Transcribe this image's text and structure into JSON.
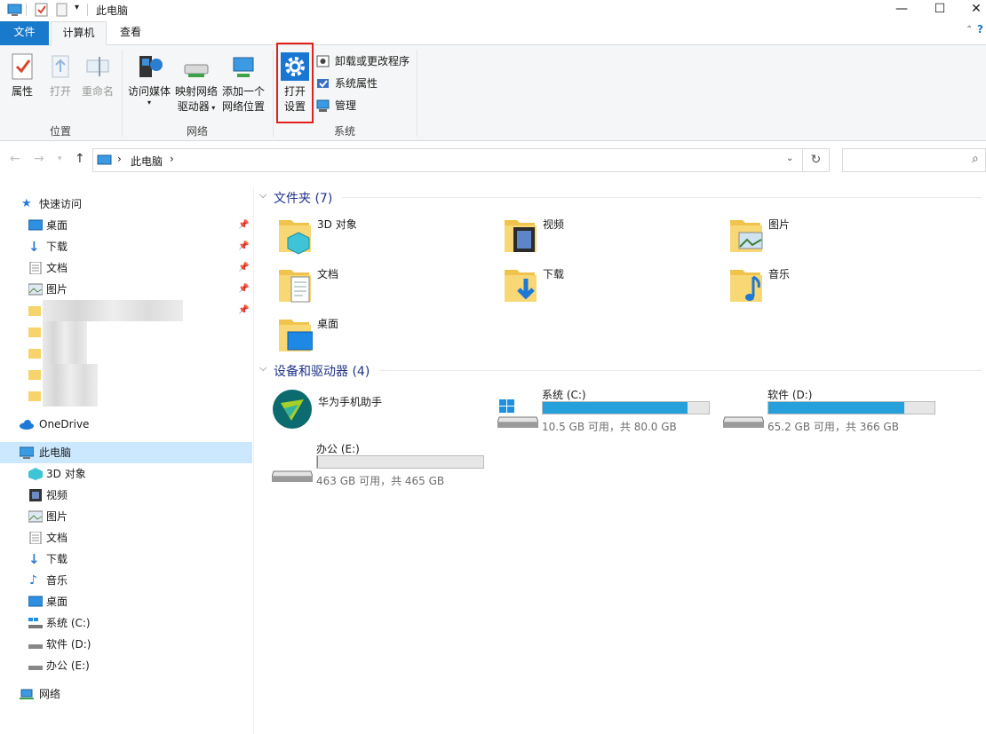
{
  "titlebar": {
    "title": "此电脑",
    "min": "—",
    "max": "☐",
    "close": "✕"
  },
  "tabs": {
    "file": "文件",
    "computer": "计算机",
    "view": "查看"
  },
  "ribbon": {
    "location": {
      "label": "位置",
      "properties": "属性",
      "open": "打开",
      "rename": "重命名"
    },
    "network": {
      "label": "网络",
      "access_media_1": "访问媒体",
      "map_drive_1": "映射网络",
      "map_drive_2": "驱动器",
      "add_location_1": "添加一个",
      "add_location_2": "网络位置"
    },
    "system": {
      "label": "系统",
      "open_settings_1": "打开",
      "open_settings_2": "设置",
      "uninstall": "卸载或更改程序",
      "sys_props": "系统属性",
      "manage": "管理"
    }
  },
  "address": {
    "path": "此电脑",
    "chevron": "›",
    "refresh": "↻",
    "search_icon": "⌕"
  },
  "nav": {
    "quick_access": "快速访问",
    "quick_items": [
      "桌面",
      "下载",
      "文档",
      "图片"
    ],
    "onedrive": "OneDrive",
    "this_pc": "此电脑",
    "pc_items": [
      "3D 对象",
      "视频",
      "图片",
      "文档",
      "下载",
      "音乐",
      "桌面",
      "系统 (C:)",
      "软件 (D:)",
      "办公 (E:)"
    ],
    "network": "网络"
  },
  "folders": {
    "heading": "文件夹 (7)",
    "items": [
      "3D 对象",
      "视频",
      "图片",
      "文档",
      "下载",
      "音乐",
      "桌面"
    ]
  },
  "devices": {
    "heading": "设备和驱动器 (4)",
    "app": "华为手机助手",
    "drives": [
      {
        "name": "系统 (C:)",
        "used_fraction": 0.87,
        "size": "10.5 GB 可用，共 80.0 GB"
      },
      {
        "name": "软件 (D:)",
        "used_fraction": 0.82,
        "size": "65.2 GB 可用，共 366 GB"
      },
      {
        "name": "办公 (E:)",
        "used_fraction": 0.004,
        "size": "463 GB 可用，共 465 GB"
      }
    ]
  }
}
